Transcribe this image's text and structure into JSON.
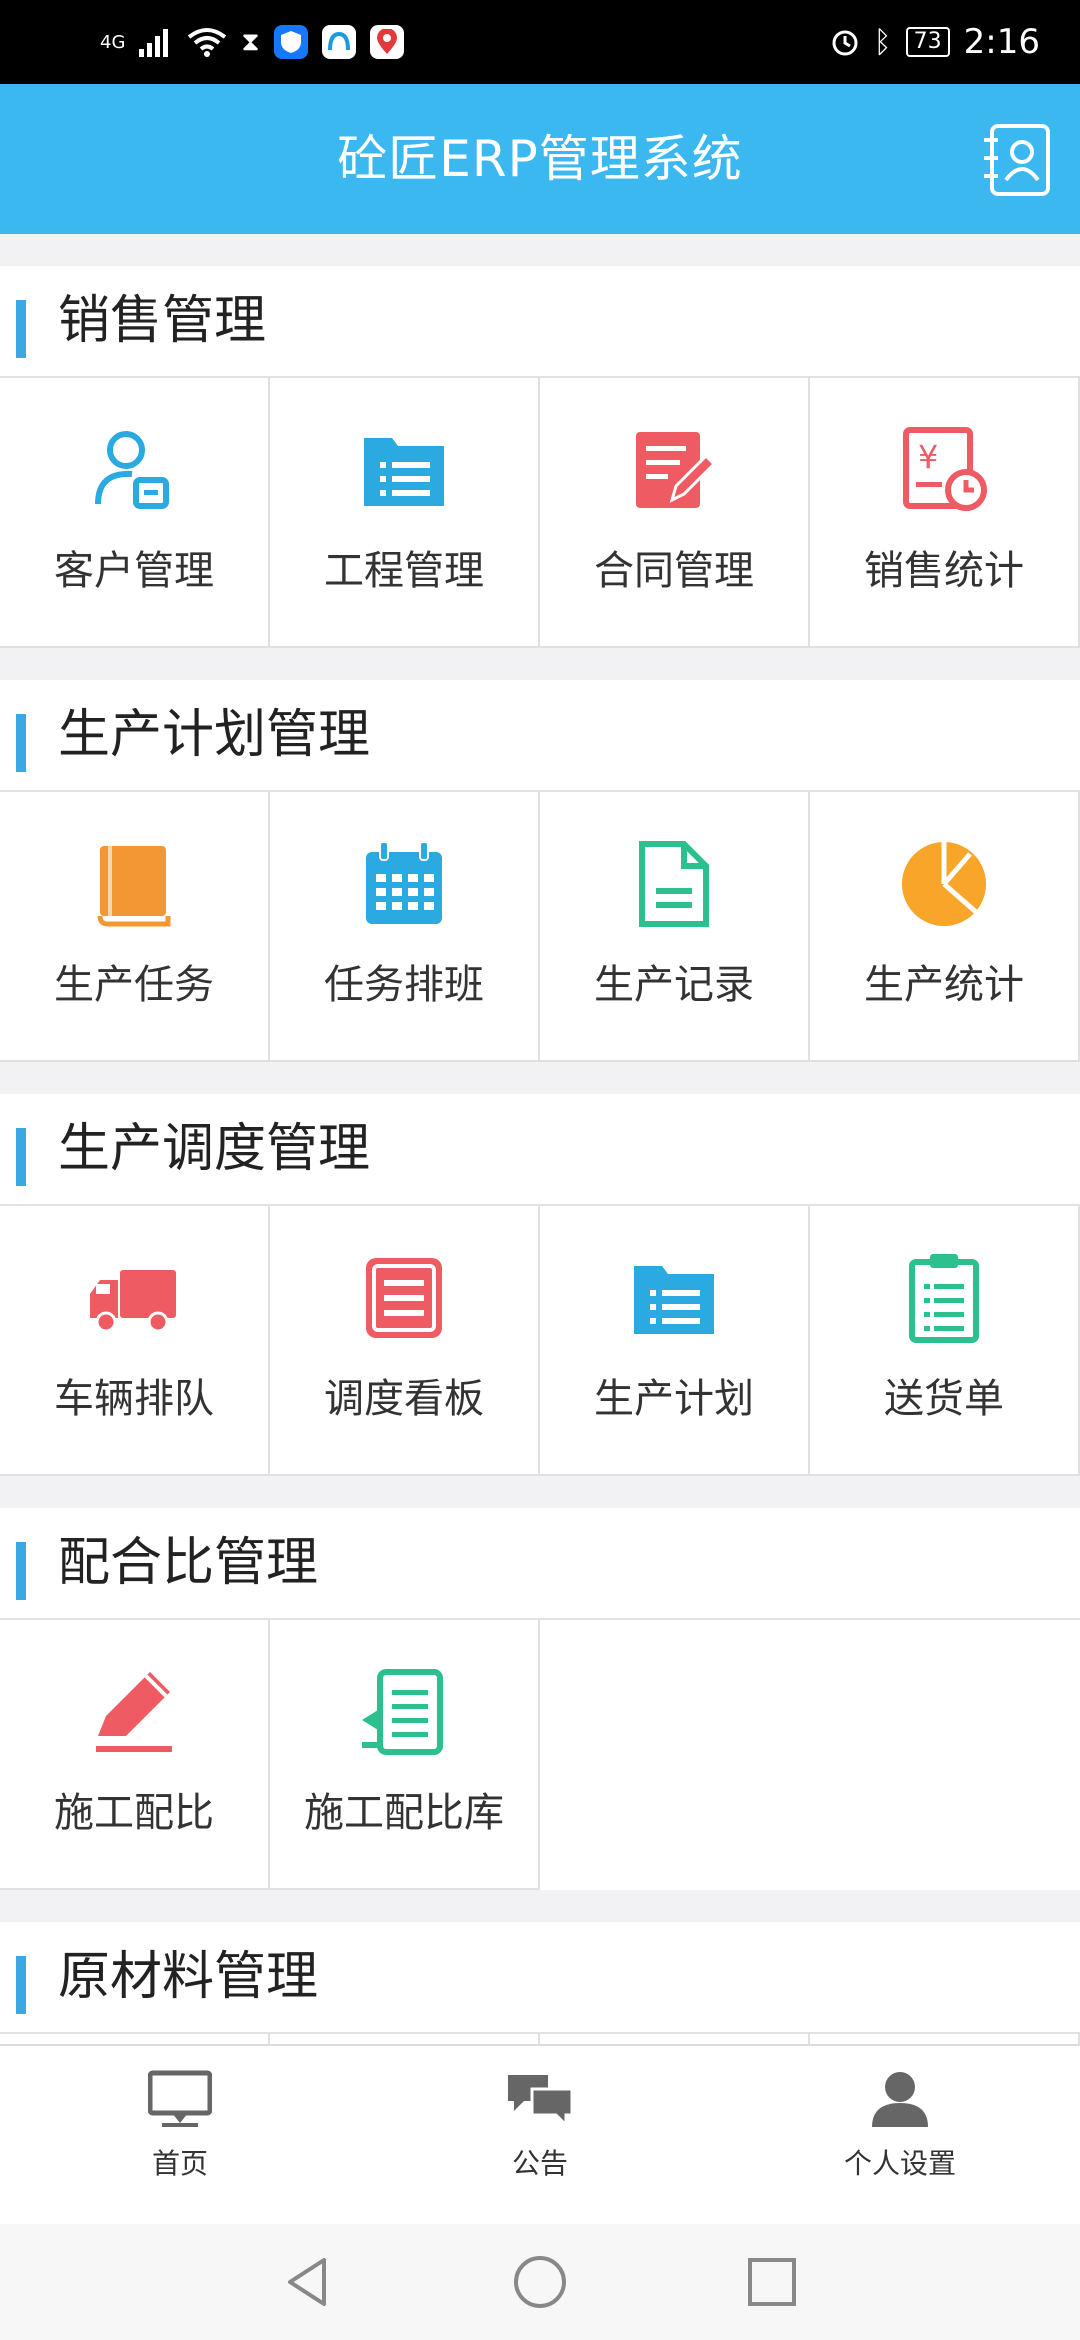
{
  "status_bar": {
    "network": "4G",
    "time": "2:16",
    "battery": "73"
  },
  "header": {
    "title": "砼匠ERP管理系统",
    "contact_icon": "contact-book-icon"
  },
  "sections": [
    {
      "title": "销售管理",
      "items": [
        {
          "label": "客户管理",
          "icon": "customer-icon",
          "color": "#2ba9e1"
        },
        {
          "label": "工程管理",
          "icon": "folder-list-icon",
          "color": "#2ba9e1"
        },
        {
          "label": "合同管理",
          "icon": "contract-edit-icon",
          "color": "#ee5b63"
        },
        {
          "label": "销售统计",
          "icon": "sales-stat-icon",
          "color": "#ee5b63"
        }
      ]
    },
    {
      "title": "生产计划管理",
      "items": [
        {
          "label": "生产任务",
          "icon": "book-icon",
          "color": "#f29733"
        },
        {
          "label": "任务排班",
          "icon": "calendar-icon",
          "color": "#2ba9e1"
        },
        {
          "label": "生产记录",
          "icon": "document-icon",
          "color": "#2bc08e"
        },
        {
          "label": "生产统计",
          "icon": "pie-chart-icon",
          "color": "#f8a52a"
        }
      ]
    },
    {
      "title": "生产调度管理",
      "items": [
        {
          "label": "车辆排队",
          "icon": "truck-icon",
          "color": "#ee5b63"
        },
        {
          "label": "调度看板",
          "icon": "board-icon",
          "color": "#ee5b63"
        },
        {
          "label": "生产计划",
          "icon": "folder-list-icon",
          "color": "#2ba9e1"
        },
        {
          "label": "送货单",
          "icon": "clipboard-icon",
          "color": "#2bc08e"
        }
      ]
    },
    {
      "title": "配合比管理",
      "items": [
        {
          "label": "施工配比",
          "icon": "pencil-icon",
          "color": "#ee5b63"
        },
        {
          "label": "施工配比库",
          "icon": "ratio-library-icon",
          "color": "#2bc08e"
        }
      ]
    },
    {
      "title": "原材料管理",
      "items": []
    }
  ],
  "tabbar": [
    {
      "label": "首页",
      "icon": "monitor-icon"
    },
    {
      "label": "公告",
      "icon": "chat-bubbles-icon"
    },
    {
      "label": "个人设置",
      "icon": "person-icon"
    }
  ],
  "navbar": {
    "back": "back-icon",
    "home": "home-circle-icon",
    "recents": "recents-square-icon"
  }
}
